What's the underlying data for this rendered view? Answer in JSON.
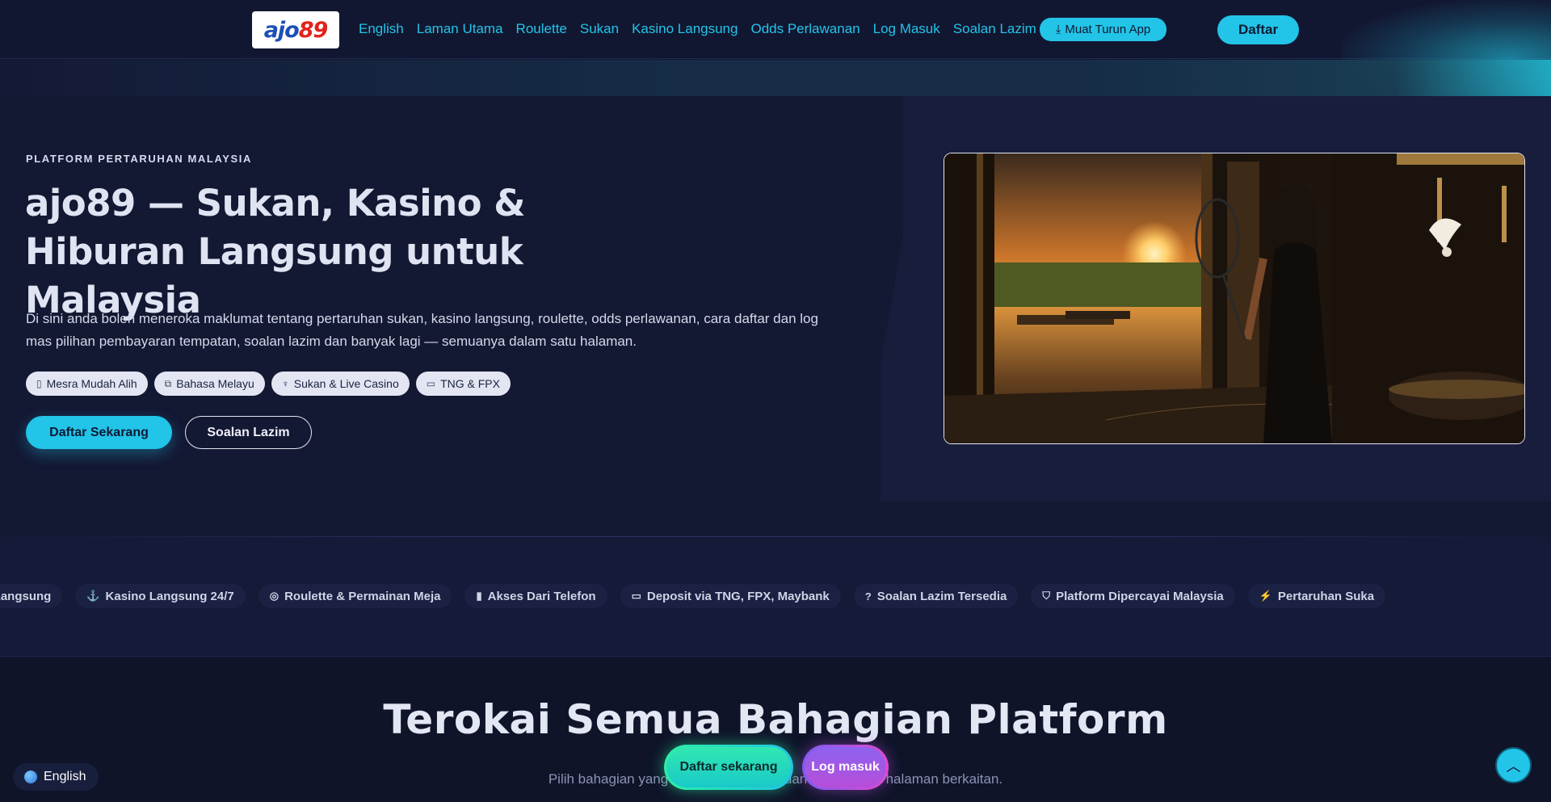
{
  "header": {
    "logo": {
      "part1": "ajo",
      "part2": "89"
    },
    "nav": [
      "English",
      "Laman Utama",
      "Roulette",
      "Sukan",
      "Kasino Langsung",
      "Odds Perlawanan",
      "Log Masuk",
      "Soalan Lazim"
    ],
    "app_button": "Muat Turun App",
    "register_button": "Daftar"
  },
  "hero": {
    "eyebrow": "PLATFORM PERTARUHAN MALAYSIA",
    "title": "ajo89 — Sukan, Kasino & Hiburan Langsung untuk Malaysia",
    "description": "Di sini anda boleh meneroka maklumat tentang pertaruhan sukan, kasino langsung, roulette, odds perlawanan, cara daftar dan log mas pilihan pembayaran tempatan, soalan lazim dan banyak lagi — semuanya dalam satu halaman.",
    "pills": [
      {
        "icon": "phone-icon",
        "label": "Mesra Mudah Alih"
      },
      {
        "icon": "language-icon",
        "label": "Bahasa Melayu"
      },
      {
        "icon": "trophy-icon",
        "label": "Sukan & Live Casino"
      },
      {
        "icon": "wallet-icon",
        "label": "TNG & FPX"
      }
    ],
    "cta_primary": "Daftar Sekarang",
    "cta_secondary": "Soalan Lazim"
  },
  "ticker": [
    {
      "icon": "",
      "label": "an Langsung"
    },
    {
      "icon": "anchor-icon",
      "label": "Kasino Langsung 24/7"
    },
    {
      "icon": "roulette-icon",
      "label": "Roulette & Permainan Meja"
    },
    {
      "icon": "phone-icon",
      "label": "Akses Dari Telefon"
    },
    {
      "icon": "wallet-icon",
      "label": "Deposit via TNG, FPX, Maybank"
    },
    {
      "icon": "question-icon",
      "label": "Soalan Lazim Tersedia"
    },
    {
      "icon": "shield-icon",
      "label": "Platform Dipercayai Malaysia"
    },
    {
      "icon": "bolt-icon",
      "label": "Pertaruhan Suka"
    }
  ],
  "section": {
    "title": "Terokai Semua Bahagian Platform",
    "subtitle": "Pilih bahagian yang ingin anda terokai dan teruskan ke halaman berkaitan."
  },
  "floating": {
    "register": "Daftar sekarang",
    "login": "Log masuk",
    "language": "English"
  },
  "colors": {
    "accent": "#22c4e8",
    "background": "#131833"
  }
}
